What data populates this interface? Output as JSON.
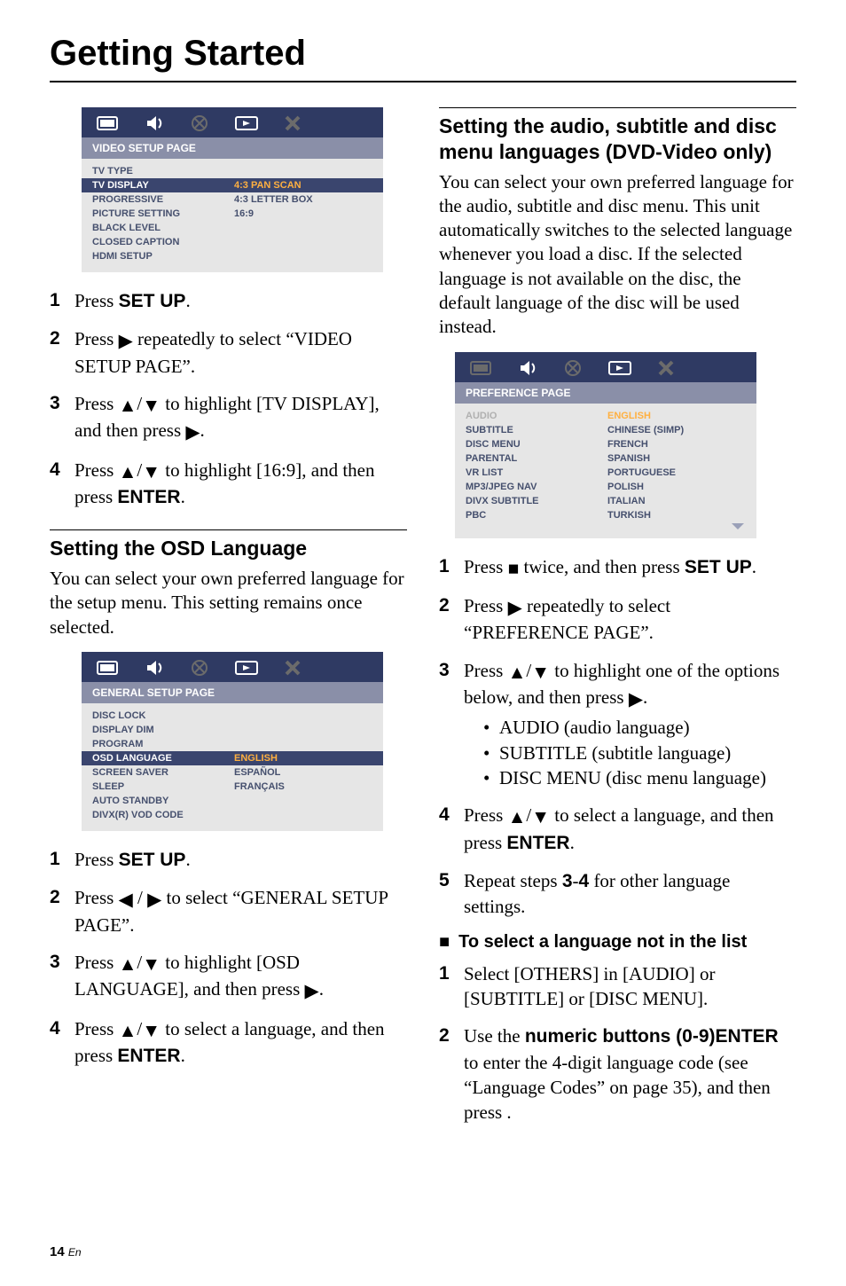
{
  "page_title": "Getting Started",
  "footer": {
    "page_num": "14",
    "locale": "En"
  },
  "osd1": {
    "tab_title": "VIDEO SETUP PAGE",
    "rows": [
      {
        "k": "TV TYPE",
        "v": ""
      },
      {
        "k": "TV DISPLAY",
        "v": "4:3 PAN SCAN",
        "sel": true
      },
      {
        "k": "PROGRESSIVE",
        "v": "4:3 LETTER BOX"
      },
      {
        "k": "PICTURE SETTING",
        "v": "16:9"
      },
      {
        "k": "BLACK LEVEL",
        "v": ""
      },
      {
        "k": "CLOSED CAPTION",
        "v": ""
      },
      {
        "k": "HDMI SETUP",
        "v": ""
      }
    ]
  },
  "osd2": {
    "tab_title": "GENERAL SETUP PAGE",
    "rows": [
      {
        "k": "DISC LOCK",
        "v": ""
      },
      {
        "k": "DISPLAY DIM",
        "v": ""
      },
      {
        "k": "PROGRAM",
        "v": ""
      },
      {
        "k": "OSD LANGUAGE",
        "v": "ENGLISH",
        "sel": true
      },
      {
        "k": "SCREEN SAVER",
        "v": "ESPAÑOL"
      },
      {
        "k": "SLEEP",
        "v": "FRANÇAIS"
      },
      {
        "k": "AUTO STANDBY",
        "v": ""
      },
      {
        "k": "DIVX(R) VOD CODE",
        "v": ""
      }
    ]
  },
  "osd3": {
    "tab_title": "PREFERENCE PAGE",
    "rows": [
      {
        "k": "AUDIO",
        "v": "ENGLISH",
        "audioHeader": true
      },
      {
        "k": "SUBTITLE",
        "v": "CHINESE (SIMP)"
      },
      {
        "k": "DISC MENU",
        "v": "FRENCH"
      },
      {
        "k": "PARENTAL",
        "v": "SPANISH"
      },
      {
        "k": "VR LIST",
        "v": "PORTUGUESE"
      },
      {
        "k": "MP3/JPEG NAV",
        "v": "POLISH"
      },
      {
        "k": "DIVX SUBTITLE",
        "v": "ITALIAN"
      },
      {
        "k": "PBC",
        "v": "TURKISH"
      }
    ]
  },
  "left": {
    "steps1": [
      {
        "n": "1",
        "pre": "Press ",
        "bold": "SET UP",
        "post": "."
      },
      {
        "n": "2",
        "text_parts": [
          "Press ",
          "SYM_RIGHT",
          " repeatedly to select “VIDEO SETUP PAGE”."
        ]
      },
      {
        "n": "3",
        "text_parts": [
          "Press ",
          "SYM_UP",
          "/",
          "SYM_DOWN",
          " to highlight [TV DISPLAY], and then press ",
          "SYM_RIGHT",
          "."
        ]
      },
      {
        "n": "4",
        "text_parts": [
          "Press ",
          "SYM_UP",
          "/",
          "SYM_DOWN",
          " to highlight [16:9], and then press "
        ],
        "bold": "ENTER",
        "post": "."
      }
    ],
    "section2_title": "Setting the OSD Language",
    "section2_body": "You can select your own preferred language for the setup menu. This setting remains once selected.",
    "steps2": [
      {
        "n": "1",
        "pre": "Press ",
        "bold": "SET UP",
        "post": "."
      },
      {
        "n": "2",
        "text_parts": [
          "Press ",
          "SYM_LEFT",
          " / ",
          "SYM_RIGHT",
          " to select “GENERAL SETUP PAGE”."
        ]
      },
      {
        "n": "3",
        "text_parts": [
          "Press ",
          "SYM_UP",
          "/",
          "SYM_DOWN",
          " to highlight [OSD LANGUAGE], and then press ",
          "SYM_RIGHT",
          "."
        ]
      },
      {
        "n": "4",
        "text_parts": [
          "Press ",
          "SYM_UP",
          "/",
          "SYM_DOWN",
          " to select a language, and then press "
        ],
        "bold": "ENTER",
        "post": "."
      }
    ]
  },
  "right": {
    "section_title": "Setting the audio, subtitle and disc menu languages (DVD-Video only)",
    "section_body": "You can select your own preferred language for the audio, subtitle and disc menu. This unit automatically switches to the selected language whenever you load a disc. If the selected language is not available on the disc, the default language of the disc will be used instead.",
    "steps": [
      {
        "n": "1",
        "text_parts": [
          "Press ",
          "SYM_STOP",
          "  twice, and then press "
        ],
        "bold": "SET UP",
        "post": "."
      },
      {
        "n": "2",
        "text_parts": [
          "Press ",
          "SYM_RIGHT",
          " repeatedly to select “PREFERENCE PAGE”."
        ]
      },
      {
        "n": "3",
        "text_parts": [
          "Press ",
          "SYM_UP",
          "/",
          "SYM_DOWN",
          " to highlight one of the options below, and then press ",
          "SYM_RIGHT",
          "."
        ],
        "bullets": [
          "AUDIO (audio language)",
          "SUBTITLE (subtitle language)",
          "DISC MENU (disc menu language)"
        ]
      },
      {
        "n": "4",
        "text_parts": [
          "Press ",
          "SYM_UP",
          "/",
          "SYM_DOWN",
          " to select a language, and then press "
        ],
        "bold": "ENTER",
        "post": "."
      },
      {
        "n": "5",
        "text_parts": [
          "Repeat steps "
        ],
        "bold": "3",
        "mid": "-",
        "bold2": "4",
        "post": " for other language settings."
      }
    ],
    "sub_title": "To select a language not in the list",
    "steps2": [
      {
        "n": "1",
        "plain": "Select [OTHERS] in [AUDIO] or [SUBTITLE] or [DISC MENU]."
      },
      {
        "n": "2",
        "pre": "Use the ",
        "bold": "numeric buttons (0-9)",
        "post_parts": [
          " to enter the 4-digit language code (see “Language Codes” on page 35), and then press "
        ],
        "bold2": "ENTER",
        "post2": "."
      }
    ]
  },
  "symbols": {
    "SYM_RIGHT": "▶",
    "SYM_LEFT": "◀",
    "SYM_UP": "▲",
    "SYM_DOWN": "▼",
    "SYM_STOP": "■"
  }
}
